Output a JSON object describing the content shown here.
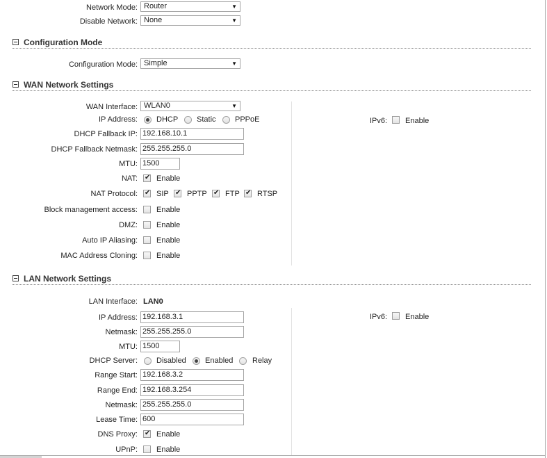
{
  "network": {
    "mode_label": "Network Mode:",
    "mode_value": "Router",
    "disable_label": "Disable Network:",
    "disable_value": "None"
  },
  "configuration": {
    "section_title": "Configuration Mode",
    "mode_label": "Configuration Mode:",
    "mode_value": "Simple"
  },
  "wan": {
    "section_title": "WAN Network Settings",
    "interface_label": "WAN Interface:",
    "interface_value": "WLAN0",
    "ip_label": "IP Address:",
    "ip_options": {
      "dhcp": "DHCP",
      "static": "Static",
      "pppoe": "PPPoE"
    },
    "ip_selected": "DHCP",
    "fallback_ip_label": "DHCP Fallback IP:",
    "fallback_ip_value": "192.168.10.1",
    "fallback_mask_label": "DHCP Fallback Netmask:",
    "fallback_mask_value": "255.255.255.0",
    "mtu_label": "MTU:",
    "mtu_value": "1500",
    "nat_label": "NAT:",
    "nat_enable": "Enable",
    "nat_protocol_label": "NAT Protocol:",
    "nat_protocols": {
      "sip": "SIP",
      "pptp": "PPTP",
      "ftp": "FTP",
      "rtsp": "RTSP"
    },
    "block_mgmt_label": "Block management access:",
    "dmz_label": "DMZ:",
    "auto_ip_label": "Auto IP Aliasing:",
    "mac_clone_label": "MAC Address Cloning:",
    "enable_text": "Enable",
    "ipv6_label": "IPv6:",
    "ipv6_enable": "Enable"
  },
  "lan": {
    "section_title": "LAN Network Settings",
    "interface_label": "LAN Interface:",
    "interface_value": "LAN0",
    "ip_label": "IP Address:",
    "ip_value": "192.168.3.1",
    "netmask_label": "Netmask:",
    "netmask_value": "255.255.255.0",
    "mtu_label": "MTU:",
    "mtu_value": "1500",
    "dhcp_label": "DHCP Server:",
    "dhcp_options": {
      "disabled": "Disabled",
      "enabled": "Enabled",
      "relay": "Relay"
    },
    "dhcp_selected": "Enabled",
    "range_start_label": "Range Start:",
    "range_start_value": "192.168.3.2",
    "range_end_label": "Range End:",
    "range_end_value": "192.168.3.254",
    "range_netmask_label": "Netmask:",
    "range_netmask_value": "255.255.255.0",
    "lease_label": "Lease Time:",
    "lease_value": "600",
    "dns_proxy_label": "DNS Proxy:",
    "upnp_label": "UPnP:",
    "enable_text": "Enable",
    "ipv6_label": "IPv6:",
    "ipv6_enable": "Enable"
  }
}
